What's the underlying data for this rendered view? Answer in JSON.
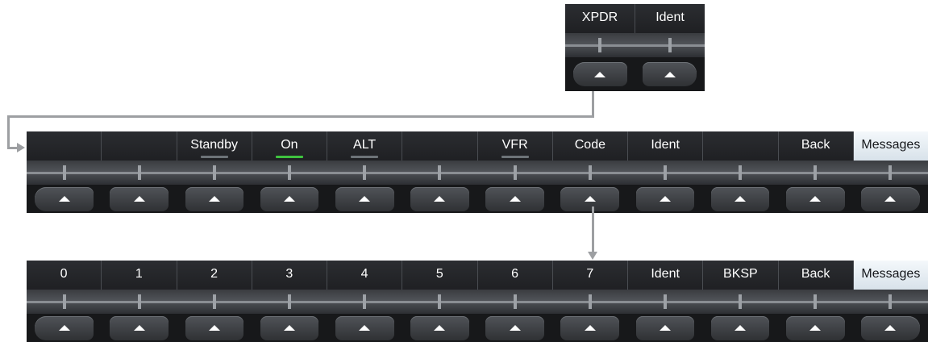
{
  "xpdr_bar": {
    "softkeys": [
      {
        "label": "XPDR",
        "indicator": "none",
        "active": false
      },
      {
        "label": "Ident",
        "indicator": "none",
        "active": false
      }
    ]
  },
  "mode_bar": {
    "softkeys": [
      {
        "label": "",
        "indicator": "none",
        "active": false
      },
      {
        "label": "",
        "indicator": "none",
        "active": false
      },
      {
        "label": "Standby",
        "indicator": "off",
        "active": false
      },
      {
        "label": "On",
        "indicator": "on",
        "active": false
      },
      {
        "label": "ALT",
        "indicator": "off",
        "active": false
      },
      {
        "label": "",
        "indicator": "none",
        "active": false
      },
      {
        "label": "VFR",
        "indicator": "off",
        "active": false
      },
      {
        "label": "Code",
        "indicator": "none",
        "active": false
      },
      {
        "label": "Ident",
        "indicator": "none",
        "active": false
      },
      {
        "label": "",
        "indicator": "none",
        "active": false
      },
      {
        "label": "Back",
        "indicator": "none",
        "active": false
      },
      {
        "label": "Messages",
        "indicator": "none",
        "active": true
      }
    ]
  },
  "code_bar": {
    "softkeys": [
      {
        "label": "0",
        "indicator": "none",
        "active": false
      },
      {
        "label": "1",
        "indicator": "none",
        "active": false
      },
      {
        "label": "2",
        "indicator": "none",
        "active": false
      },
      {
        "label": "3",
        "indicator": "none",
        "active": false
      },
      {
        "label": "4",
        "indicator": "none",
        "active": false
      },
      {
        "label": "5",
        "indicator": "none",
        "active": false
      },
      {
        "label": "6",
        "indicator": "none",
        "active": false
      },
      {
        "label": "7",
        "indicator": "none",
        "active": false
      },
      {
        "label": "Ident",
        "indicator": "none",
        "active": false
      },
      {
        "label": "BKSP",
        "indicator": "none",
        "active": false
      },
      {
        "label": "Back",
        "indicator": "none",
        "active": false
      },
      {
        "label": "Messages",
        "indicator": "none",
        "active": true
      }
    ]
  },
  "colors": {
    "indicator_on": "#3fc23f",
    "indicator_off": "#6d7378",
    "active_key_bg": "#e6eef4",
    "connector": "#9d9fa2"
  }
}
